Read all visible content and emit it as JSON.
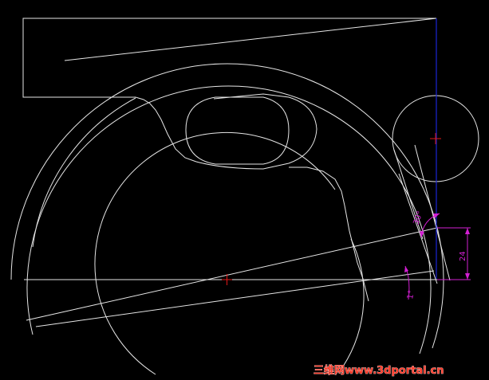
{
  "viewport": {
    "background_color": "#000000",
    "line_color": "#e6e6e6",
    "axis_line_color": "#1a24d6",
    "dimension_color": "#d21fd2",
    "center_mark_color": "#e01818"
  },
  "dimensions": {
    "vertical_distance": "24",
    "upper_angle": "30°",
    "lower_angle": "1°"
  },
  "watermark": {
    "text": "三维网www.3dportal.cn"
  }
}
